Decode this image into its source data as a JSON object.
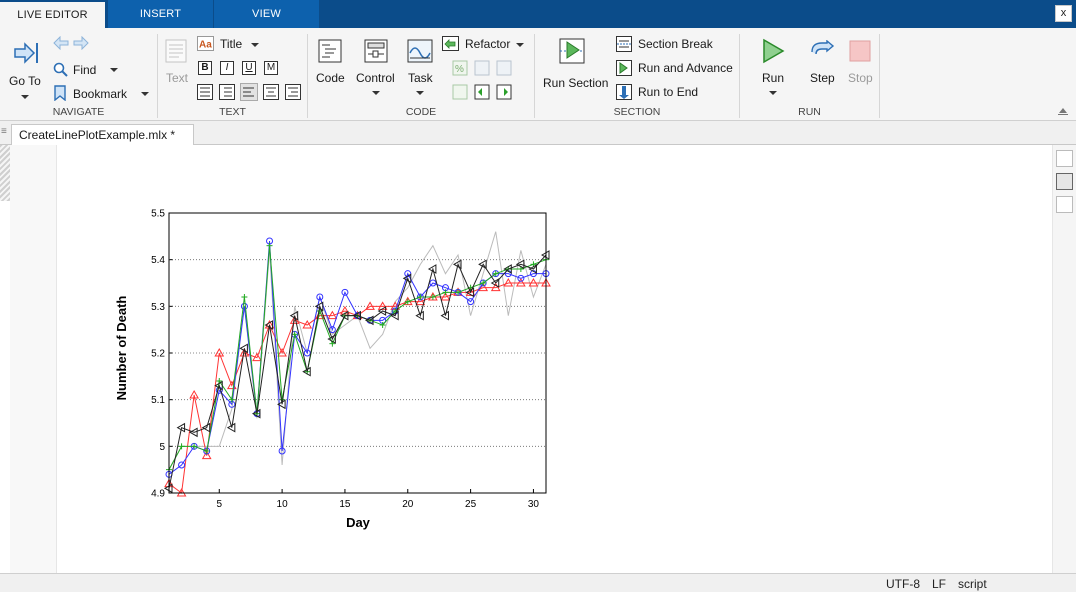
{
  "tabs": [
    {
      "label": "LIVE EDITOR",
      "active": true
    },
    {
      "label": "INSERT",
      "active": false
    },
    {
      "label": "VIEW",
      "active": false
    }
  ],
  "window": {
    "close_label": "x"
  },
  "ribbon": {
    "navigate": {
      "label": "NAVIGATE",
      "goto": "Go To",
      "find": "Find",
      "bookmark": "Bookmark"
    },
    "text": {
      "label": "TEXT",
      "text_btn": "Text",
      "title": "Title",
      "bold": "B",
      "italic": "I",
      "underline": "U",
      "mono": "M"
    },
    "code": {
      "label": "CODE",
      "code": "Code",
      "control": "Control",
      "task": "Task",
      "refactor": "Refactor"
    },
    "section": {
      "label": "SECTION",
      "run_section": "Run Section",
      "section_break": "Section Break",
      "run_and_advance": "Run and Advance",
      "run_to_end": "Run to End"
    },
    "run": {
      "label": "RUN",
      "run": "Run",
      "step": "Step",
      "stop": "Stop"
    }
  },
  "document": {
    "tab_label": "CreateLinePlotExample.mlx *"
  },
  "status": {
    "encoding": "UTF-8",
    "line_ending": "LF",
    "type": "script"
  },
  "colors": {
    "accent": "#0b4c8a",
    "red": "#ff3333",
    "blue": "#3333ff",
    "green": "#22aa22",
    "black": "#222222",
    "gray": "#bbbbbb"
  },
  "chart_data": {
    "type": "line",
    "xlabel": "Day",
    "ylabel": "Number of Death",
    "xlim": [
      1,
      31
    ],
    "ylim": [
      4.9,
      5.5
    ],
    "xticks": [
      5,
      10,
      15,
      20,
      25,
      30
    ],
    "yticks": [
      4.9,
      5,
      5.1,
      5.2,
      5.3,
      5.4,
      5.5
    ],
    "grid": "horizontal-dotted",
    "series": [
      {
        "color": "#bbbbbb",
        "marker": "none",
        "values": [
          4.95,
          5.0,
          5.0,
          5.0,
          5.0,
          5.08,
          5.3,
          5.06,
          5.42,
          4.96,
          5.3,
          5.2,
          5.32,
          5.24,
          5.26,
          5.28,
          5.21,
          5.24,
          5.31,
          5.34,
          5.39,
          5.43,
          5.37,
          5.41,
          5.28,
          5.37,
          5.46,
          5.28,
          5.42,
          5.32,
          5.39
        ]
      },
      {
        "color": "#ff3333",
        "marker": "triangle-up",
        "values": [
          4.92,
          4.9,
          5.11,
          4.98,
          5.2,
          5.13,
          5.2,
          5.19,
          5.26,
          5.2,
          5.27,
          5.26,
          5.28,
          5.28,
          5.29,
          5.28,
          5.3,
          5.3,
          5.3,
          5.31,
          5.31,
          5.32,
          5.32,
          5.33,
          5.33,
          5.34,
          5.34,
          5.35,
          5.35,
          5.35,
          5.35
        ]
      },
      {
        "color": "#3333ff",
        "marker": "circle",
        "values": [
          4.94,
          4.96,
          5.0,
          4.99,
          5.12,
          5.09,
          5.3,
          5.07,
          5.44,
          4.99,
          5.24,
          5.2,
          5.32,
          5.25,
          5.33,
          5.28,
          5.27,
          5.27,
          5.29,
          5.37,
          5.32,
          5.35,
          5.34,
          5.33,
          5.31,
          5.35,
          5.37,
          5.37,
          5.36,
          5.37,
          5.37
        ]
      },
      {
        "color": "#22aa22",
        "marker": "plus",
        "values": [
          4.95,
          5.0,
          5.0,
          4.99,
          5.14,
          5.1,
          5.32,
          5.07,
          5.43,
          5.1,
          5.24,
          5.16,
          5.29,
          5.22,
          5.28,
          5.28,
          5.27,
          5.26,
          5.29,
          5.31,
          5.32,
          5.32,
          5.33,
          5.33,
          5.34,
          5.35,
          5.37,
          5.38,
          5.38,
          5.39,
          5.4
        ]
      },
      {
        "color": "#222222",
        "marker": "triangle-left",
        "values": [
          4.91,
          5.04,
          5.03,
          5.04,
          5.13,
          5.04,
          5.21,
          5.07,
          5.26,
          5.09,
          5.28,
          5.16,
          5.3,
          5.23,
          5.28,
          5.28,
          5.27,
          5.29,
          5.28,
          5.36,
          5.28,
          5.38,
          5.28,
          5.39,
          5.33,
          5.39,
          5.35,
          5.38,
          5.39,
          5.38,
          5.41
        ]
      }
    ]
  }
}
